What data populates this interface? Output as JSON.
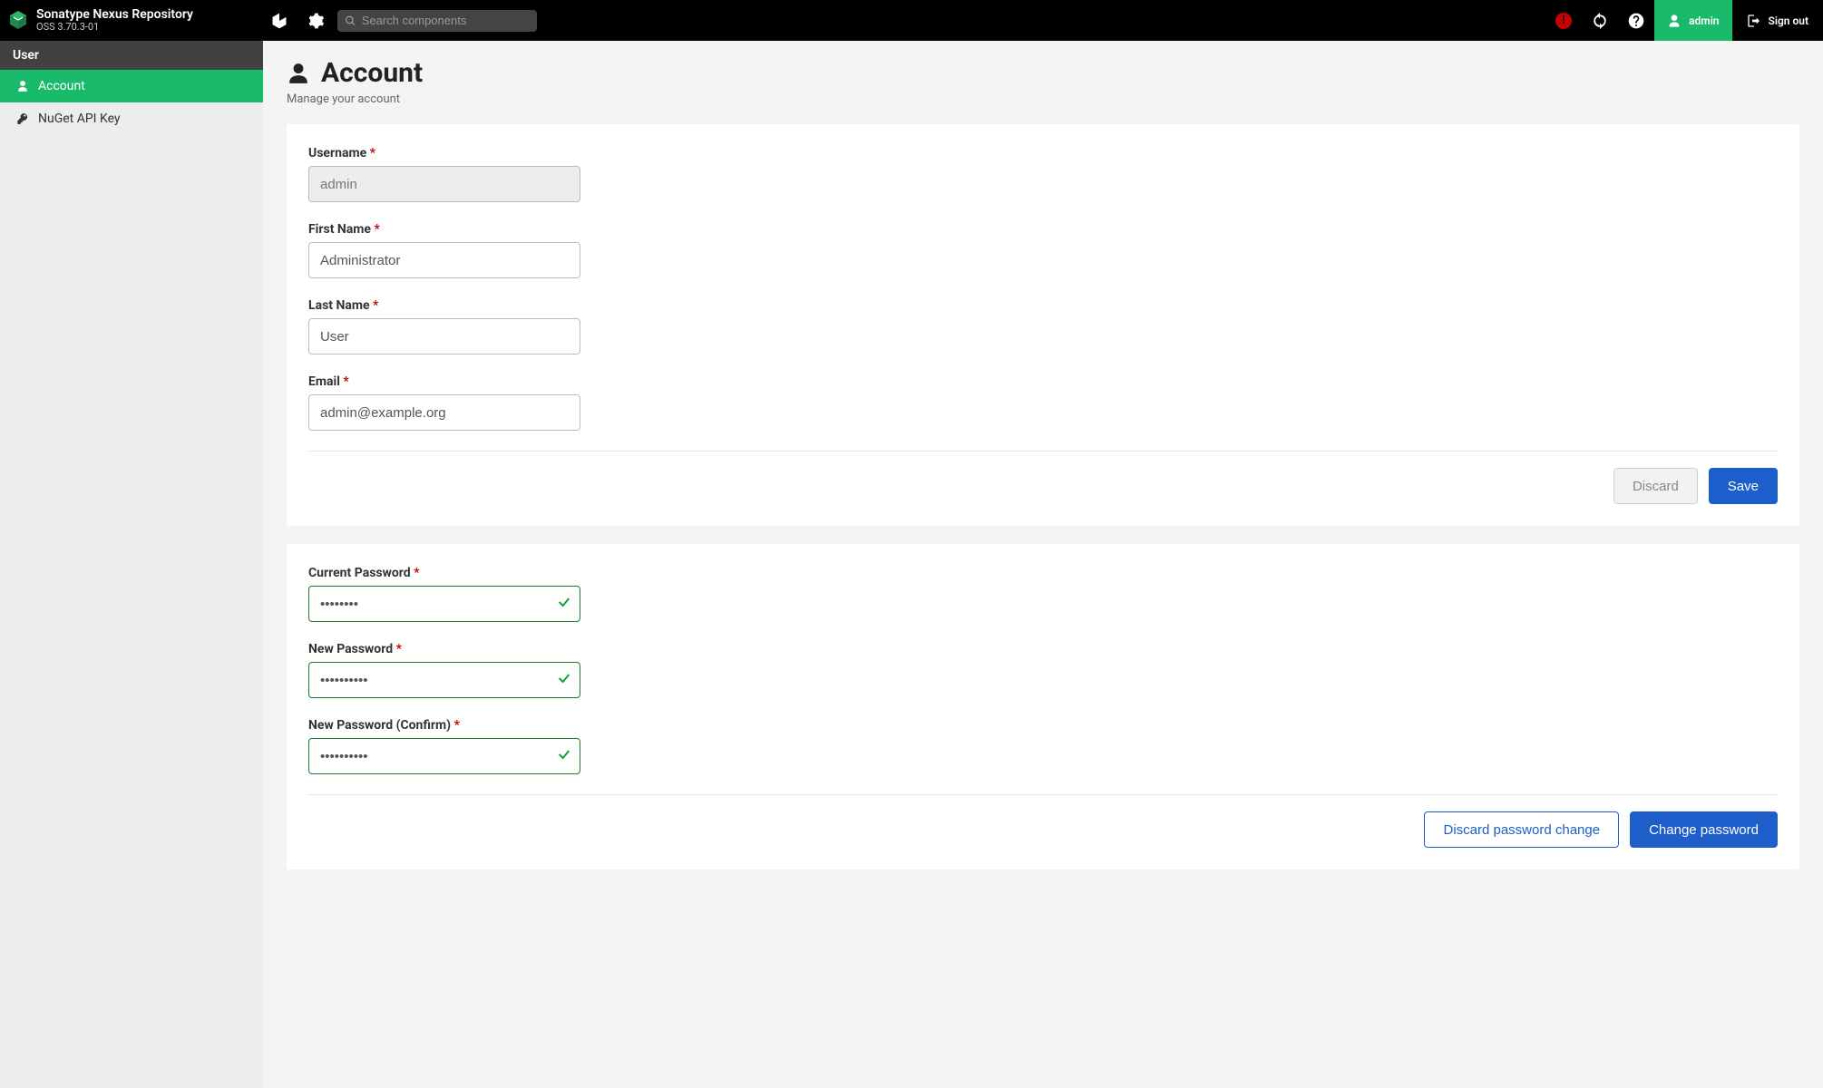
{
  "header": {
    "brand_title": "Sonatype Nexus Repository",
    "brand_sub": "OSS 3.70.3-01",
    "search_placeholder": "Search components",
    "user_name": "admin",
    "signout_label": "Sign out"
  },
  "sidebar": {
    "section_title": "User",
    "items": [
      {
        "label": "Account",
        "icon": "user-icon",
        "active": true
      },
      {
        "label": "NuGet API Key",
        "icon": "key-icon",
        "active": false
      }
    ]
  },
  "page": {
    "title": "Account",
    "subtitle": "Manage your account"
  },
  "account_form": {
    "username_label": "Username",
    "username_value": "admin",
    "firstname_label": "First Name",
    "firstname_value": "Administrator",
    "lastname_label": "Last Name",
    "lastname_value": "User",
    "email_label": "Email",
    "email_value": "admin@example.org",
    "discard_label": "Discard",
    "save_label": "Save"
  },
  "password_form": {
    "current_label": "Current Password",
    "current_value": "••••••••",
    "new_label": "New Password",
    "new_value": "••••••••••",
    "confirm_label": "New Password (Confirm)",
    "confirm_value": "••••••••••",
    "discard_label": "Discard password change",
    "change_label": "Change password"
  }
}
